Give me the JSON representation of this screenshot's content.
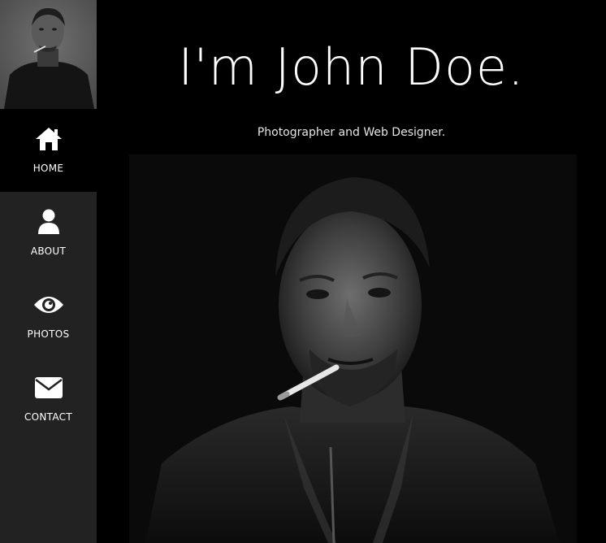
{
  "sidebar": {
    "avatar_alt": "John Doe portrait",
    "items": [
      {
        "label": "HOME",
        "icon": "home-icon",
        "active": true
      },
      {
        "label": "ABOUT",
        "icon": "user-icon",
        "active": false
      },
      {
        "label": "PHOTOS",
        "icon": "eye-icon",
        "active": false
      },
      {
        "label": "CONTACT",
        "icon": "envelope-icon",
        "active": false
      }
    ]
  },
  "main": {
    "title": "I'm John Doe.",
    "subtitle": "Photographer and Web Designer."
  },
  "colors": {
    "sidebar_bg": "#222222",
    "active_bg": "#000000",
    "page_bg": "#000000",
    "text": "#ffffff"
  }
}
